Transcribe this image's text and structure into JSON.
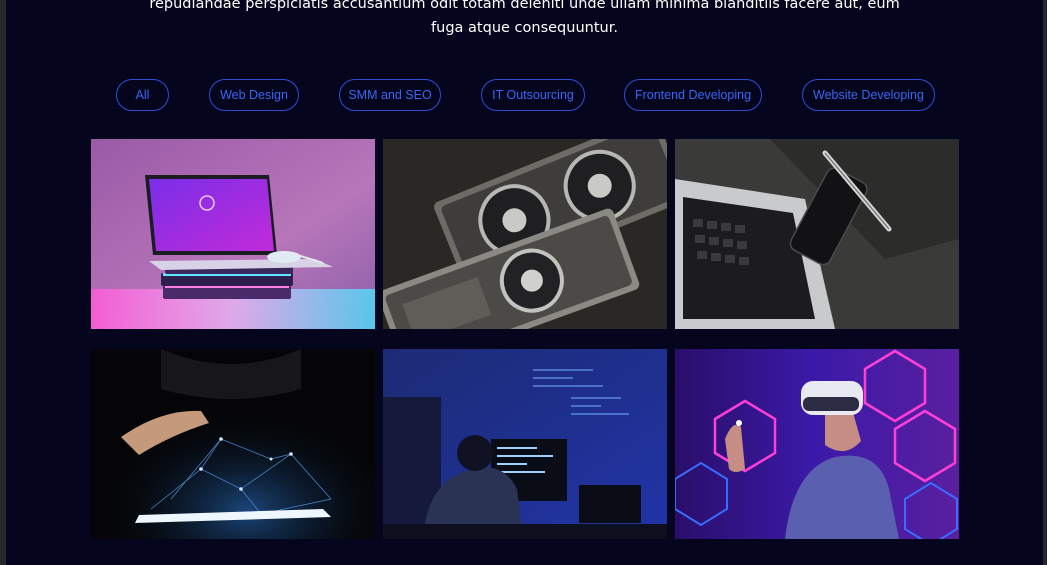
{
  "intro": {
    "line1": "repudiandae perspiciatis accusantium odit totam deleniti unde ullam minima blanditiis facere aut, eum",
    "line2": "fuga atque consequuntur."
  },
  "filters": [
    {
      "label": "All"
    },
    {
      "label": "Web Design"
    },
    {
      "label": "SMM and SEO"
    },
    {
      "label": "IT Outsourcing"
    },
    {
      "label": "Frontend Developing"
    },
    {
      "label": "Website Developing"
    }
  ],
  "portfolio": [
    {
      "image": "laptop-on-books-pink-neon"
    },
    {
      "image": "graphics-cards"
    },
    {
      "image": "laptop-phone-notebook"
    },
    {
      "image": "hand-holographic-tablet"
    },
    {
      "image": "developer-at-monitors"
    },
    {
      "image": "vr-headset-neon-hexagons"
    }
  ],
  "colors": {
    "background": "#05051d",
    "accent": "#3b66f4",
    "text": "#ffffff"
  }
}
